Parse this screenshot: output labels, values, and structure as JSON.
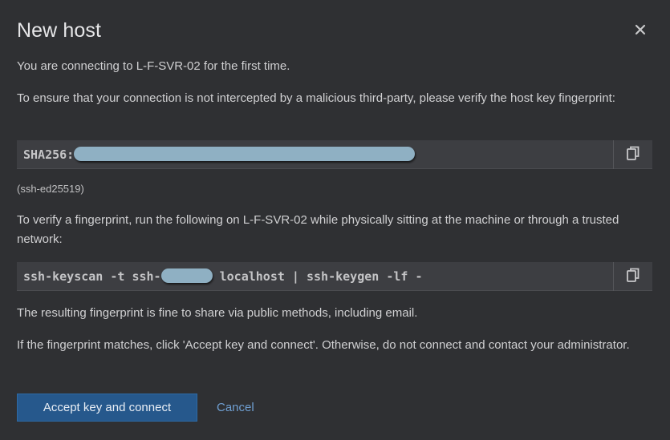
{
  "dialog": {
    "title": "New host",
    "intro": "You are connecting to L-F-SVR-02 for the first time.",
    "ensure": "To ensure that your connection is not intercepted by a malicious third-party, please verify the host key fingerprint:",
    "fingerprint_prefix": "SHA256:",
    "key_type": "(ssh-ed25519)",
    "verify_instructions": "To verify a fingerprint, run the following on L-F-SVR-02 while physically sitting at the machine or through a trusted network:",
    "command_prefix": "ssh-keyscan -t ssh-",
    "command_suffix": " localhost | ssh-keygen -lf -",
    "share_note": "The resulting fingerprint is fine to share via public methods, including email.",
    "match_note": "If the fingerprint matches, click 'Accept key and connect'. Otherwise, do not connect and contact your administrator.",
    "accept_label": "Accept key and connect",
    "cancel_label": "Cancel"
  },
  "icons": {
    "close": "close-icon",
    "copy": "copy-icon"
  },
  "colors": {
    "background": "#2f3033",
    "primary_button": "#26588c",
    "link": "#6f9fd2",
    "redaction": "#8fb0c3"
  }
}
